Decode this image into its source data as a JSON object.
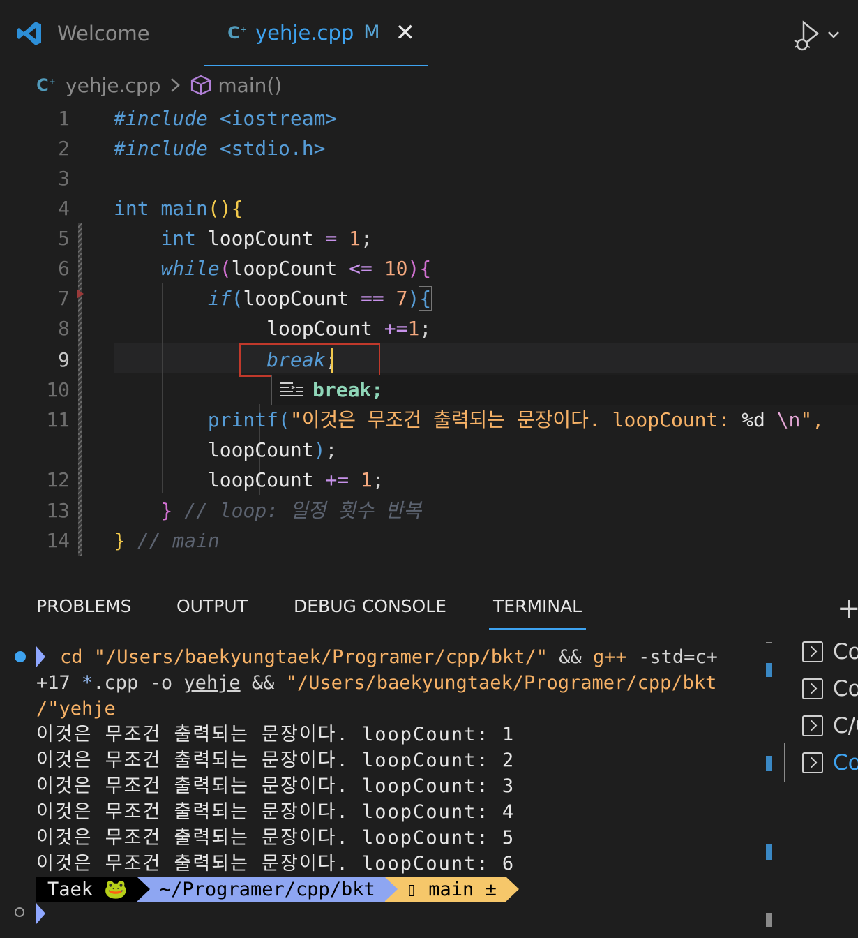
{
  "tabs": [
    {
      "label": "Welcome"
    },
    {
      "label": "yehje.cpp",
      "modified": "M",
      "close": "✕"
    }
  ],
  "breadcrumb": {
    "file": "yehje.cpp",
    "symbol": "main()"
  },
  "editor": {
    "line_numbers": [
      "1",
      "2",
      "3",
      "4",
      "5",
      "6",
      "7",
      "8",
      "9",
      "10",
      "11",
      "",
      "12",
      "13",
      "14"
    ],
    "code": {
      "l1_kw": "#include",
      "l1_rest": " <iostream>",
      "l2_kw": "#include",
      "l2_rest": " <stdio.h>",
      "l4_type": "int",
      "l4_fn": " main",
      "l4_p": "()",
      "l4_b": "{",
      "l5_type": "int",
      "l5_var": " loopCount ",
      "l5_op": "= ",
      "l5_num": "1",
      "l5_end": ";",
      "l6_kw": "while",
      "l6_p1": "(",
      "l6_var": "loopCount ",
      "l6_op": "<= ",
      "l6_num": "10",
      "l6_p2": ")",
      "l6_b": "{",
      "l7_kw": "if",
      "l7_p1": "(",
      "l7_var": "loopCount ",
      "l7_op": "== ",
      "l7_num": "7",
      "l7_p2": ")",
      "l7_b": "{",
      "l8_var": "loopCount ",
      "l8_op": "+=",
      "l8_num": "1",
      "l8_end": ";",
      "l9_kw": "break",
      "l9_end": ";",
      "l11_fn": "printf",
      "l11_p": "(",
      "l11_str": "\"이것은 무조건 출력되는 문장이다. loopCount: ",
      "l11_fmt": "%d ",
      "l11_esc": "\\n",
      "l11_str2": "\",",
      "l11b_var": "loopCount",
      "l11b_p": ")",
      "l11b_end": ";",
      "l12_var": "loopCount ",
      "l12_op": "+= ",
      "l12_num": "1",
      "l12_end": ";",
      "l13_b": "}",
      "l13_cmt": " // loop: 일정 횟수 반복",
      "l14_b": "}",
      "l14_cmt": " // main"
    },
    "suggestion": "break;"
  },
  "panel": {
    "tabs": [
      "PROBLEMS",
      "OUTPUT",
      "DEBUG CONSOLE",
      "TERMINAL"
    ],
    "add": "+"
  },
  "terminal": {
    "cmd_cd": "cd ",
    "cmd_path1": "\"/Users/baekyungtaek/Programer/cpp/bkt/\"",
    "cmd_and1": " && ",
    "cmd_gpp": "g++",
    "cmd_std_a": " -std=c+",
    "cmd_std_b": "+17 ",
    "cmd_glob": "*",
    "cmd_cpp": ".cpp -o ",
    "cmd_out": "yehje",
    "cmd_and2": " && ",
    "cmd_path2a": "\"/Users/baekyungtaek/Programer/cpp/bkt",
    "cmd_path2b": "/\"yehje",
    "output": [
      "이것은 무조건 출력되는 문장이다. loopCount: 1",
      "이것은 무조건 출력되는 문장이다. loopCount: 2",
      "이것은 무조건 출력되는 문장이다. loopCount: 3",
      "이것은 무조건 출력되는 문장이다. loopCount: 4",
      "이것은 무조건 출력되는 문장이다. loopCount: 5",
      "이것은 무조건 출력되는 문장이다. loopCount: 6"
    ],
    "prompt": {
      "user": "Taek 🐸",
      "path": "~/Programer/cpp/bkt",
      "git": " main ±"
    }
  },
  "terminal_list": [
    "Co",
    "Co",
    "C/C",
    "Co"
  ],
  "colors": {
    "accent": "#3ea3f0",
    "selection_border": "#c0392b",
    "cursor": "#f2c94c"
  }
}
